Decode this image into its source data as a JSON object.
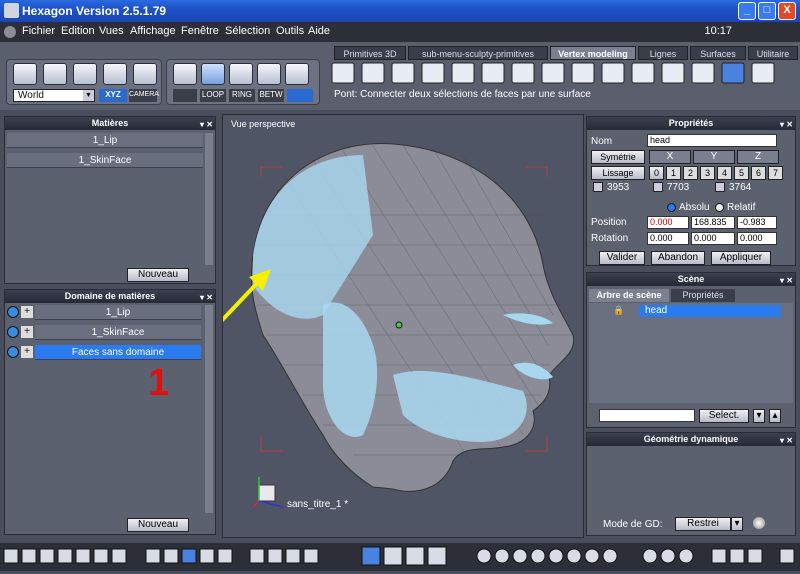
{
  "window": {
    "title": "Hexagon Version 2.5.1.79",
    "clock": "10:17",
    "min": "_",
    "max": "□",
    "close": "X"
  },
  "menu": [
    "Fichier",
    "Edition",
    "Vues",
    "Affichage",
    "Fenêtre",
    "Sélection",
    "Outils",
    "Aide"
  ],
  "tabs": [
    "Primitives 3D",
    "sub-menu-sculpty-primitives",
    "Vertex modeling",
    "Lignes",
    "Surfaces",
    "Utilitaire"
  ],
  "toolbar": {
    "coord": "World",
    "xyz": "XYZ",
    "camera": "CAMERA",
    "loop": "LOOP",
    "ring": "RING",
    "betw": "BETW"
  },
  "status": "Pont: Connecter deux sélections de faces par une surface",
  "materials": {
    "title": "Matières",
    "items": [
      "1_Lip",
      "1_SkinFace"
    ],
    "new_btn": "Nouveau"
  },
  "domains": {
    "title": "Domaine de matières",
    "items": [
      "1_Lip",
      "1_SkinFace",
      "Faces sans domaine"
    ],
    "new_btn": "Nouveau"
  },
  "annotation": {
    "number": "1",
    "arrow_color": "#f4f000",
    "number_color": "#e01010"
  },
  "viewport": {
    "label": "Vue perspective",
    "object_label": "sans_titre_1 *"
  },
  "properties": {
    "title": "Propriétés",
    "name_label": "Nom",
    "name_value": "head",
    "symmetry": "Symétrie",
    "x": "X",
    "y": "Y",
    "z": "Z",
    "smooth": "Lissage",
    "levels": [
      "0",
      "1",
      "2",
      "3",
      "4",
      "5",
      "6",
      "7"
    ],
    "counts": [
      "3953",
      "7703",
      "3764"
    ],
    "absolute": "Absolu",
    "relative": "Relatif",
    "position_label": "Position",
    "position": [
      "0.000",
      "168.835",
      "-0.983"
    ],
    "rotation_label": "Rotation",
    "rotation": [
      "0.000",
      "0.000",
      "0.000"
    ],
    "validate": "Valider",
    "cancel": "Abandon",
    "apply": "Appliquer"
  },
  "scene": {
    "title": "Scène",
    "tab1": "Arbre de scène",
    "tab2": "Propriétés",
    "item": "head",
    "select_btn": "Select."
  },
  "dyn": {
    "title": "Géométrie dynamique",
    "mode_label": "Mode de GD:",
    "mode_value": "Restrei"
  }
}
